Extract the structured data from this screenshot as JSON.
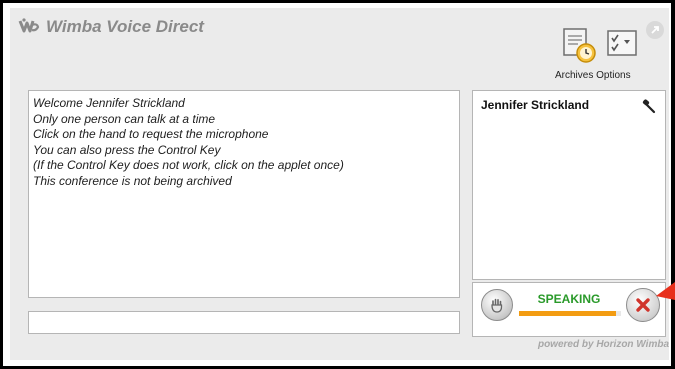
{
  "app": {
    "title": "Wimba Voice Direct",
    "logo_icon": "wimba-logo-icon",
    "external_icon": "external-window-icon"
  },
  "toolbar": {
    "archives_icon": "archives-calendar-clock-icon",
    "options_icon": "options-checklist-icon",
    "label": "Archives Options"
  },
  "chat": {
    "messages": [
      "Welcome Jennifer Strickland",
      "Only one person can talk at a time",
      "Click on the hand to request the microphone",
      "You can also press the Control Key",
      "(If the Control Key does not work, click on the applet once)",
      "This conference is not being archived"
    ],
    "input_value": ""
  },
  "participants": [
    {
      "name": "Jennifer Strickland",
      "status_icon": "microphone-icon"
    }
  ],
  "talk": {
    "hand_icon": "raise-hand-icon",
    "status": "SPEAKING",
    "status_color": "#2a9a2a",
    "level_fraction": 0.95,
    "level_color": "#f39c12",
    "stop_icon": "stop-x-icon",
    "stop_color": "#d0342c"
  },
  "footer": {
    "powered_by": "powered by Horizon Wimba"
  },
  "colors": {
    "panel": "#ebebeb",
    "title": "#8a8a8a",
    "annotation_arrow": "#e8301c"
  }
}
